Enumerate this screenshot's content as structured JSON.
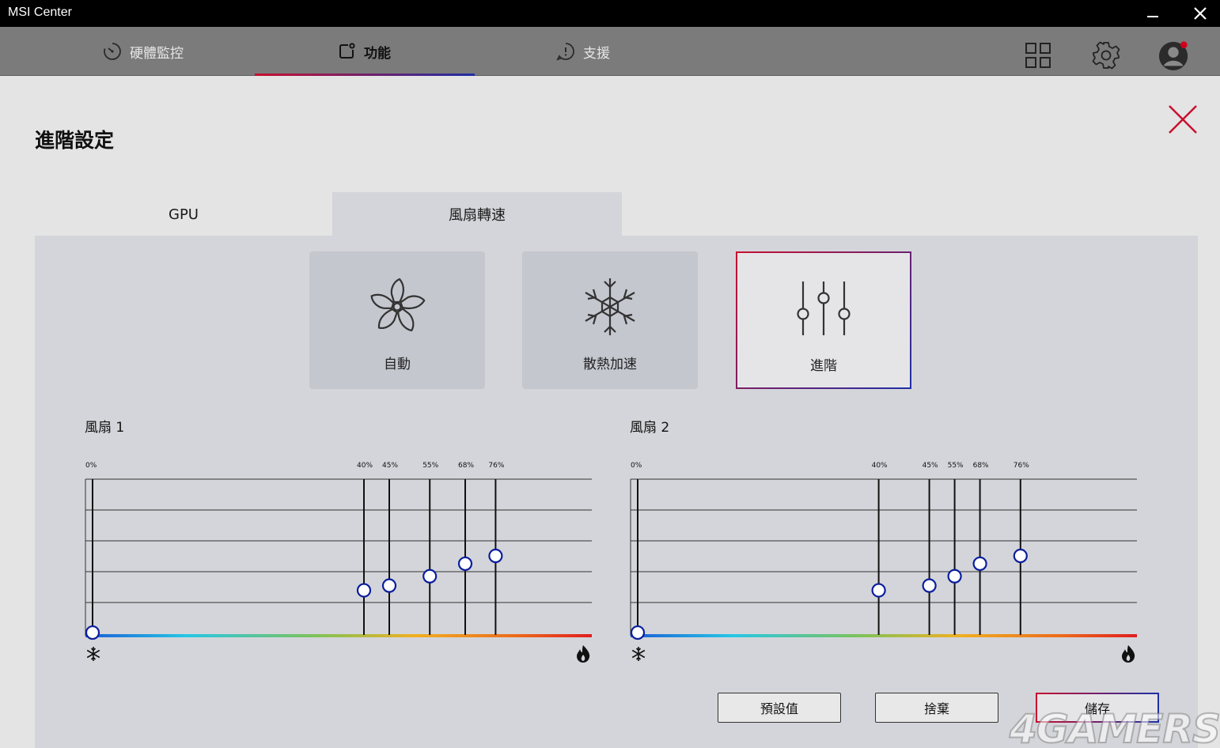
{
  "window": {
    "title": "MSI Center"
  },
  "nav": {
    "tabs": [
      {
        "label": "硬體監控",
        "icon": "gauge-icon",
        "active": false
      },
      {
        "label": "功能",
        "icon": "feature-icon",
        "active": true
      },
      {
        "label": "支援",
        "icon": "support-icon",
        "active": false
      }
    ],
    "right_icons": [
      "grid-icon",
      "gear-icon",
      "avatar"
    ]
  },
  "page": {
    "title": "進階設定",
    "tabs": [
      {
        "label": "GPU",
        "active": false
      },
      {
        "label": "風扇轉速",
        "active": true
      }
    ]
  },
  "modes": [
    {
      "label": "自動",
      "icon": "fan-icon",
      "selected": false
    },
    {
      "label": "散熱加速",
      "icon": "snowflake-icon",
      "selected": false
    },
    {
      "label": "進階",
      "icon": "sliders-icon",
      "selected": true
    }
  ],
  "fans": [
    {
      "title": "風扇 1",
      "points": [
        {
          "label": "0%",
          "temp": 0,
          "speed": 2
        },
        {
          "label": "40%",
          "temp": 55,
          "speed": 29
        },
        {
          "label": "45%",
          "temp": 60,
          "speed": 32
        },
        {
          "label": "55%",
          "temp": 68,
          "speed": 38
        },
        {
          "label": "68%",
          "temp": 75,
          "speed": 46
        },
        {
          "label": "76%",
          "temp": 81,
          "speed": 51
        }
      ]
    },
    {
      "title": "風扇 2",
      "points": [
        {
          "label": "0%",
          "temp": 0,
          "speed": 2
        },
        {
          "label": "40%",
          "temp": 49,
          "speed": 29
        },
        {
          "label": "45%",
          "temp": 59,
          "speed": 32
        },
        {
          "label": "55%",
          "temp": 64,
          "speed": 38
        },
        {
          "label": "68%",
          "temp": 69,
          "speed": 46
        },
        {
          "label": "76%",
          "temp": 77,
          "speed": 51
        }
      ]
    }
  ],
  "buttons": {
    "default": "預設值",
    "discard": "捨棄",
    "save": "儲存"
  },
  "watermark": "4GAMERS",
  "colors": {
    "accent_red": "#c8102e",
    "accent_blue": "#1f2fa6",
    "point_blue": "#0a1e9c"
  }
}
